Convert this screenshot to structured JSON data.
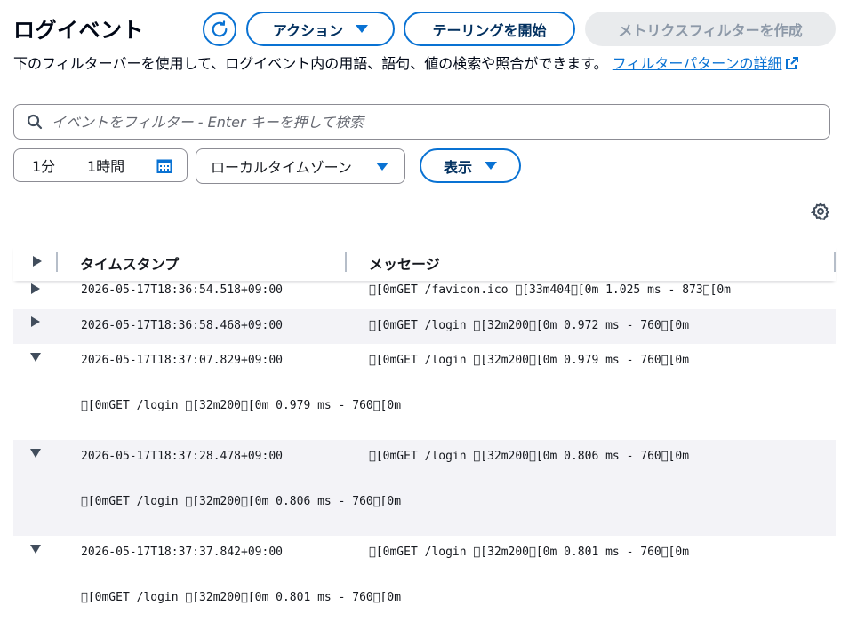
{
  "header": {
    "title": "ログイベント",
    "refresh_icon": "refresh-icon",
    "action_label": "アクション",
    "tail_label": "テーリングを開始",
    "metric_filter_label": "メトリクスフィルターを作成"
  },
  "description": {
    "text": "下のフィルターバーを使用して、ログイベント内の用語、語句、値の検索や照合ができます。",
    "link_text": "フィルターパターンの詳細",
    "link_icon": "external-link-icon"
  },
  "search": {
    "placeholder": "イベントをフィルター - Enter キーを押して検索",
    "value": ""
  },
  "time_range": {
    "option_1": "1分",
    "option_2": "1時間",
    "calendar_icon": "calendar-icon"
  },
  "timezone": {
    "selected": "ローカルタイムゾーン"
  },
  "display_label": "表示",
  "settings_icon": "gear-icon",
  "table": {
    "columns": [
      "タイムスタンプ",
      "メッセージ"
    ],
    "rows": [
      {
        "timestamp": "2026-05-17T18:36:54.518+09:00",
        "message": "\u0000[0mGET /favicon.ico \u0000[33m404\u0000[0m 1.025 ms - 873\u0000[0m",
        "expanded": false
      },
      {
        "timestamp": "2026-05-17T18:36:58.468+09:00",
        "message": "\u0000[0mGET /login \u0000[32m200\u0000[0m 0.972 ms - 760\u0000[0m",
        "expanded": false
      },
      {
        "timestamp": "2026-05-17T18:37:07.829+09:00",
        "message": "\u0000[0mGET /login \u0000[32m200\u0000[0m 0.979 ms - 760\u0000[0m",
        "expanded": true,
        "detail": "\u0000[0mGET /login \u0000[32m200\u0000[0m 0.979 ms - 760\u0000[0m"
      },
      {
        "timestamp": "2026-05-17T18:37:28.478+09:00",
        "message": "\u0000[0mGET /login \u0000[32m200\u0000[0m 0.806 ms - 760\u0000[0m",
        "expanded": true,
        "detail": "\u0000[0mGET /login \u0000[32m200\u0000[0m 0.806 ms - 760\u0000[0m"
      },
      {
        "timestamp": "2026-05-17T18:37:37.842+09:00",
        "message": "\u0000[0mGET /login \u0000[32m200\u0000[0m 0.801 ms - 760\u0000[0m",
        "expanded": true,
        "detail": "\u0000[0mGET /login \u0000[32m200\u0000[0m 0.801 ms - 760\u0000[0m"
      }
    ]
  }
}
